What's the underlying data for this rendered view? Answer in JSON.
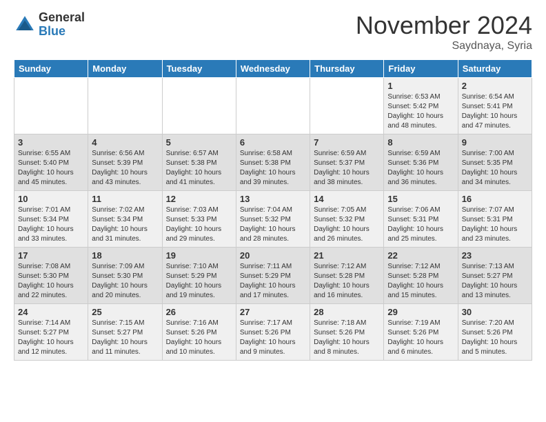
{
  "header": {
    "logo_general": "General",
    "logo_blue": "Blue",
    "month": "November 2024",
    "location": "Saydnaya, Syria"
  },
  "days_of_week": [
    "Sunday",
    "Monday",
    "Tuesday",
    "Wednesday",
    "Thursday",
    "Friday",
    "Saturday"
  ],
  "weeks": [
    [
      {
        "day": "",
        "info": ""
      },
      {
        "day": "",
        "info": ""
      },
      {
        "day": "",
        "info": ""
      },
      {
        "day": "",
        "info": ""
      },
      {
        "day": "",
        "info": ""
      },
      {
        "day": "1",
        "info": "Sunrise: 6:53 AM\nSunset: 5:42 PM\nDaylight: 10 hours\nand 48 minutes."
      },
      {
        "day": "2",
        "info": "Sunrise: 6:54 AM\nSunset: 5:41 PM\nDaylight: 10 hours\nand 47 minutes."
      }
    ],
    [
      {
        "day": "3",
        "info": "Sunrise: 6:55 AM\nSunset: 5:40 PM\nDaylight: 10 hours\nand 45 minutes."
      },
      {
        "day": "4",
        "info": "Sunrise: 6:56 AM\nSunset: 5:39 PM\nDaylight: 10 hours\nand 43 minutes."
      },
      {
        "day": "5",
        "info": "Sunrise: 6:57 AM\nSunset: 5:38 PM\nDaylight: 10 hours\nand 41 minutes."
      },
      {
        "day": "6",
        "info": "Sunrise: 6:58 AM\nSunset: 5:38 PM\nDaylight: 10 hours\nand 39 minutes."
      },
      {
        "day": "7",
        "info": "Sunrise: 6:59 AM\nSunset: 5:37 PM\nDaylight: 10 hours\nand 38 minutes."
      },
      {
        "day": "8",
        "info": "Sunrise: 6:59 AM\nSunset: 5:36 PM\nDaylight: 10 hours\nand 36 minutes."
      },
      {
        "day": "9",
        "info": "Sunrise: 7:00 AM\nSunset: 5:35 PM\nDaylight: 10 hours\nand 34 minutes."
      }
    ],
    [
      {
        "day": "10",
        "info": "Sunrise: 7:01 AM\nSunset: 5:34 PM\nDaylight: 10 hours\nand 33 minutes."
      },
      {
        "day": "11",
        "info": "Sunrise: 7:02 AM\nSunset: 5:34 PM\nDaylight: 10 hours\nand 31 minutes."
      },
      {
        "day": "12",
        "info": "Sunrise: 7:03 AM\nSunset: 5:33 PM\nDaylight: 10 hours\nand 29 minutes."
      },
      {
        "day": "13",
        "info": "Sunrise: 7:04 AM\nSunset: 5:32 PM\nDaylight: 10 hours\nand 28 minutes."
      },
      {
        "day": "14",
        "info": "Sunrise: 7:05 AM\nSunset: 5:32 PM\nDaylight: 10 hours\nand 26 minutes."
      },
      {
        "day": "15",
        "info": "Sunrise: 7:06 AM\nSunset: 5:31 PM\nDaylight: 10 hours\nand 25 minutes."
      },
      {
        "day": "16",
        "info": "Sunrise: 7:07 AM\nSunset: 5:31 PM\nDaylight: 10 hours\nand 23 minutes."
      }
    ],
    [
      {
        "day": "17",
        "info": "Sunrise: 7:08 AM\nSunset: 5:30 PM\nDaylight: 10 hours\nand 22 minutes."
      },
      {
        "day": "18",
        "info": "Sunrise: 7:09 AM\nSunset: 5:30 PM\nDaylight: 10 hours\nand 20 minutes."
      },
      {
        "day": "19",
        "info": "Sunrise: 7:10 AM\nSunset: 5:29 PM\nDaylight: 10 hours\nand 19 minutes."
      },
      {
        "day": "20",
        "info": "Sunrise: 7:11 AM\nSunset: 5:29 PM\nDaylight: 10 hours\nand 17 minutes."
      },
      {
        "day": "21",
        "info": "Sunrise: 7:12 AM\nSunset: 5:28 PM\nDaylight: 10 hours\nand 16 minutes."
      },
      {
        "day": "22",
        "info": "Sunrise: 7:12 AM\nSunset: 5:28 PM\nDaylight: 10 hours\nand 15 minutes."
      },
      {
        "day": "23",
        "info": "Sunrise: 7:13 AM\nSunset: 5:27 PM\nDaylight: 10 hours\nand 13 minutes."
      }
    ],
    [
      {
        "day": "24",
        "info": "Sunrise: 7:14 AM\nSunset: 5:27 PM\nDaylight: 10 hours\nand 12 minutes."
      },
      {
        "day": "25",
        "info": "Sunrise: 7:15 AM\nSunset: 5:27 PM\nDaylight: 10 hours\nand 11 minutes."
      },
      {
        "day": "26",
        "info": "Sunrise: 7:16 AM\nSunset: 5:26 PM\nDaylight: 10 hours\nand 10 minutes."
      },
      {
        "day": "27",
        "info": "Sunrise: 7:17 AM\nSunset: 5:26 PM\nDaylight: 10 hours\nand 9 minutes."
      },
      {
        "day": "28",
        "info": "Sunrise: 7:18 AM\nSunset: 5:26 PM\nDaylight: 10 hours\nand 8 minutes."
      },
      {
        "day": "29",
        "info": "Sunrise: 7:19 AM\nSunset: 5:26 PM\nDaylight: 10 hours\nand 6 minutes."
      },
      {
        "day": "30",
        "info": "Sunrise: 7:20 AM\nSunset: 5:26 PM\nDaylight: 10 hours\nand 5 minutes."
      }
    ]
  ]
}
